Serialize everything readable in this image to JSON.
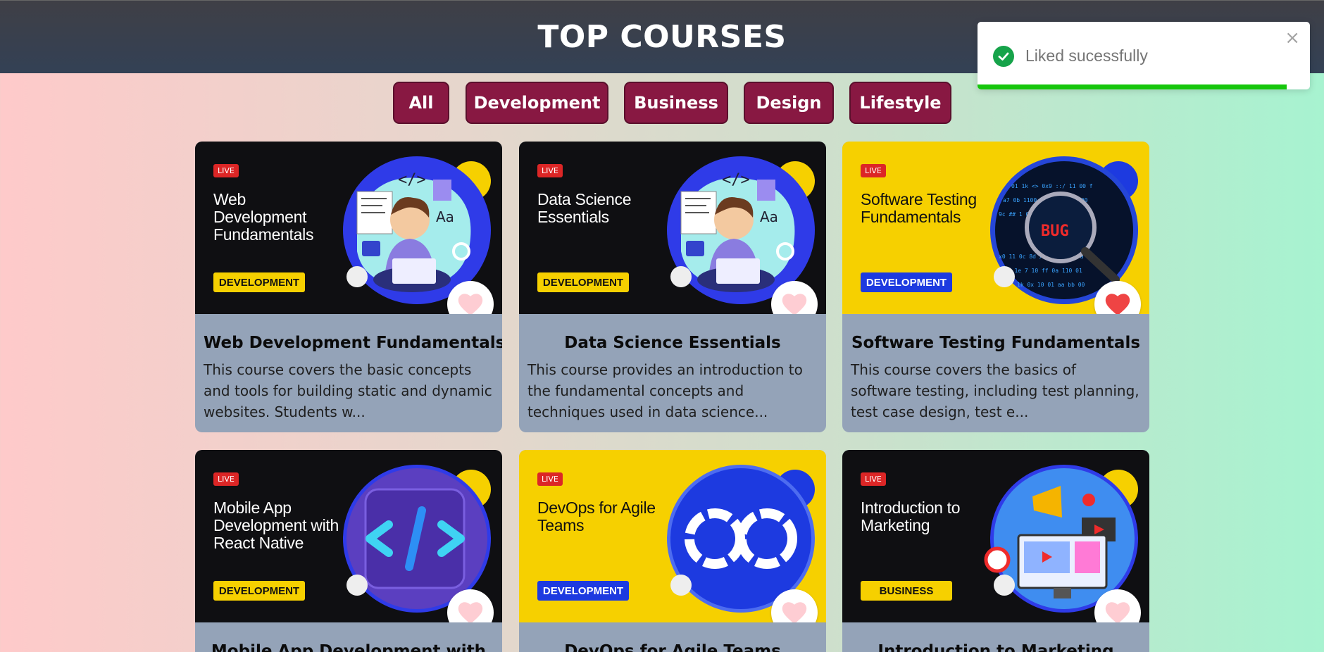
{
  "header": {
    "title": "TOP COURSES"
  },
  "filters": [
    "All",
    "Development",
    "Business",
    "Design",
    "Lifestyle"
  ],
  "toast": {
    "message": "Liked sucessfully",
    "close": "×",
    "progress": 0.93
  },
  "courses": [
    {
      "live": "LIVE",
      "thumb_title": "Web Development Fundamentals",
      "tag": "DEVELOPMENT",
      "title": "Web Development Fundamentals",
      "description": "This course covers the basic concepts and tools for building static and dynamic websites. Students w...",
      "liked": false
    },
    {
      "live": "LIVE",
      "thumb_title": "Data Science Essentials",
      "tag": "DEVELOPMENT",
      "title": "Data Science Essentials",
      "description": "This course provides an introduction to the fundamental concepts and techniques used in data science...",
      "liked": false
    },
    {
      "live": "LIVE",
      "thumb_title": "Software Testing Fundamentals",
      "tag": "DEVELOPMENT",
      "title": "Software Testing Fundamentals",
      "description": "This course covers the basics of software testing, including test planning, test case design, test e...",
      "liked": true
    },
    {
      "live": "LIVE",
      "thumb_title": "Mobile App Development with React Native",
      "tag": "DEVELOPMENT",
      "title": "Mobile App Development with",
      "liked": false
    },
    {
      "live": "LIVE",
      "thumb_title": "DevOps for Agile Teams",
      "tag": "DEVELOPMENT",
      "title": "DevOps for Agile Teams",
      "liked": false
    },
    {
      "live": "LIVE",
      "thumb_title": "Introduction to Marketing",
      "tag": "BUSINESS",
      "title": "Introduction to Marketing",
      "liked": false
    }
  ],
  "colors": {
    "filter_bg": "#881842",
    "card_body": "#94a3b8",
    "like_active": "#ef4444",
    "like_inactive": "#fecdd3",
    "toast_progress": "#16c60c"
  }
}
